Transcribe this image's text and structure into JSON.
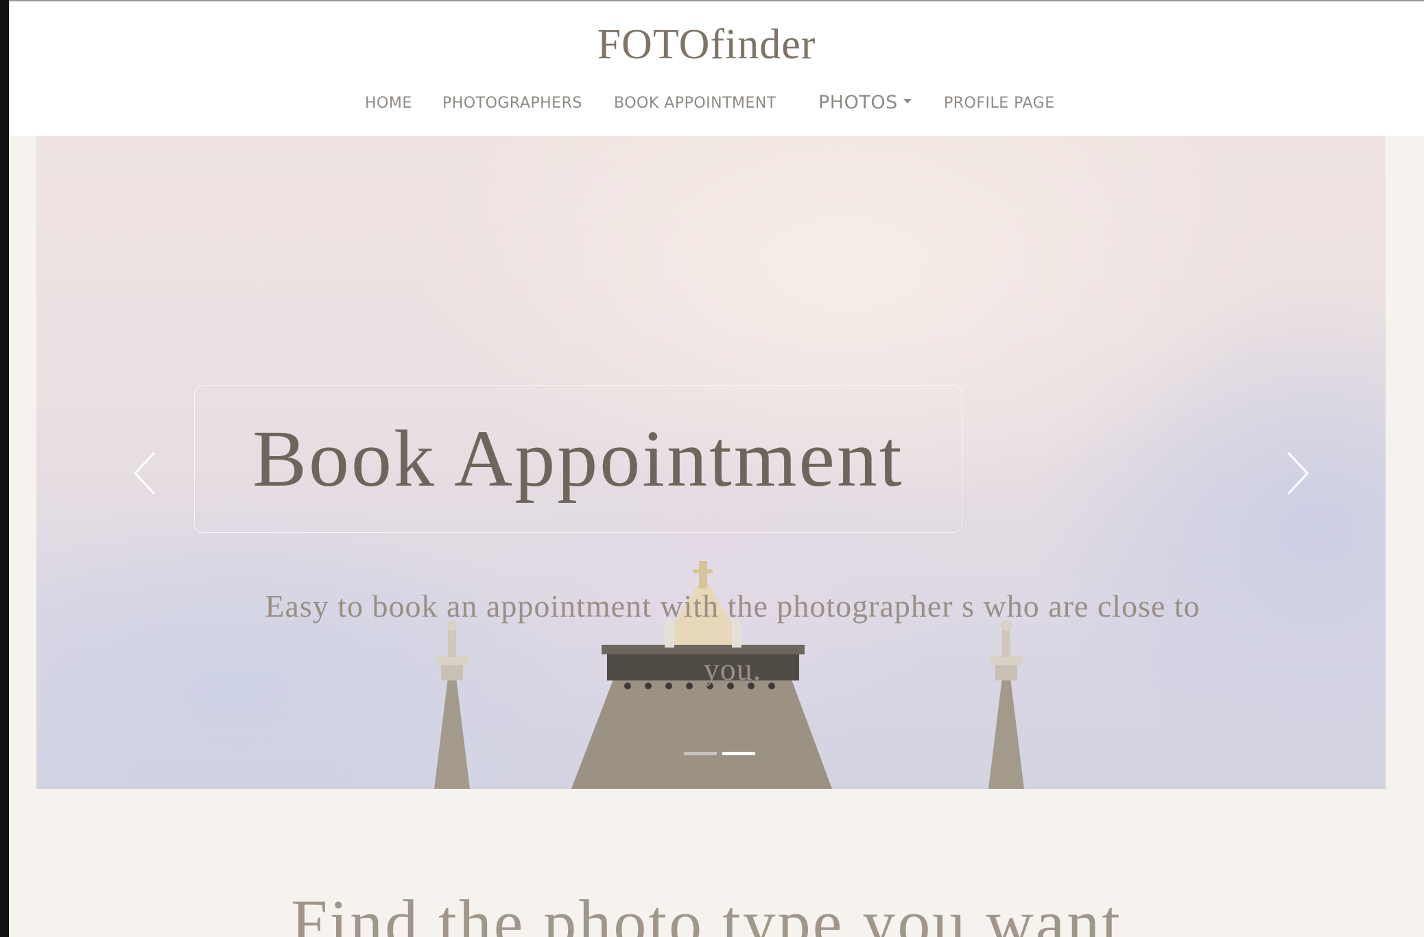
{
  "header": {
    "brand": "FOTOfinder",
    "nav": [
      {
        "label": "HOME"
      },
      {
        "label": "PHOTOGRAPHERS"
      },
      {
        "label": "BOOK APPOINTMENT"
      },
      {
        "label": "PHOTOS",
        "has_dropdown": true
      },
      {
        "label": "PROFILE PAGE"
      }
    ]
  },
  "hero": {
    "title": "Book Appointment",
    "description": "Easy to book an appointment with the photographer s who are close to you.",
    "slide_count": 2,
    "active_slide": 2,
    "prev_icon": "chevron-left-icon",
    "next_icon": "chevron-right-icon"
  },
  "section": {
    "title": "Find the photo type you want"
  },
  "colors": {
    "brand": "#7d7366",
    "nav_text": "#8f8a85",
    "page_background": "#f6f3ef",
    "hero_title": "#6d665c"
  }
}
